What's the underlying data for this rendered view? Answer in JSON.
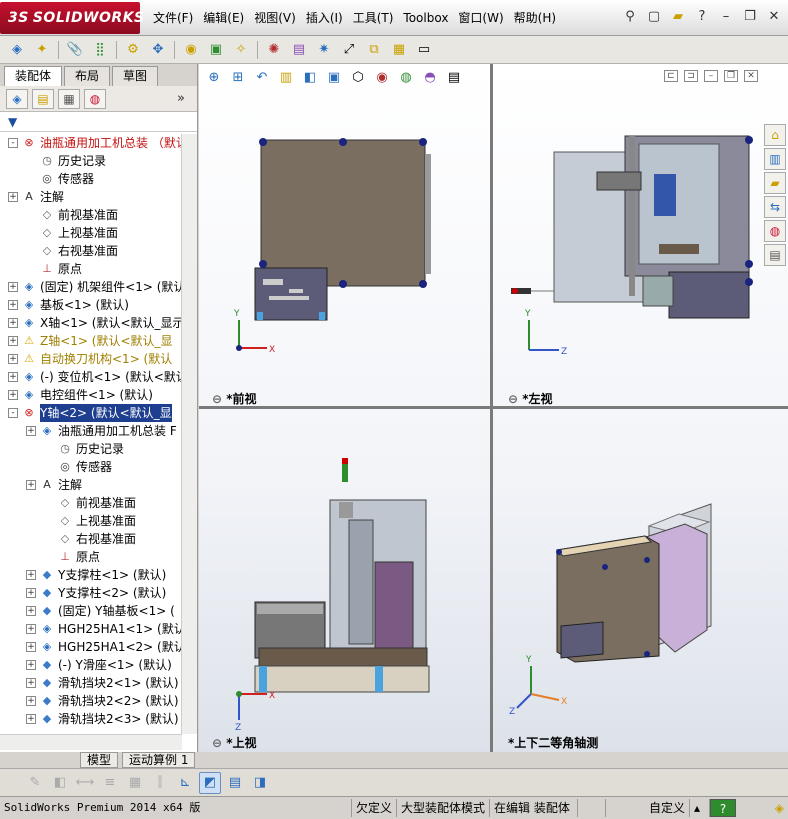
{
  "app": {
    "logo": "SOLIDWORKS",
    "logo_prefix": "3S"
  },
  "menu": [
    "文件(F)",
    "编辑(E)",
    "视图(V)",
    "插入(I)",
    "工具(T)",
    "Toolbox",
    "窗口(W)",
    "帮助(H)"
  ],
  "panel": {
    "tabs": [
      "装配体",
      "布局",
      "草图"
    ],
    "filter_label": "▼",
    "tree": [
      {
        "label": "油瓶通用加工机总装 （默认",
        "icon": "assembly-error-icon",
        "indent": 0,
        "exp": "-",
        "style": "red"
      },
      {
        "label": "历史记录",
        "icon": "history-icon",
        "indent": 1,
        "exp": "",
        "style": ""
      },
      {
        "label": "传感器",
        "icon": "sensor-icon",
        "indent": 1,
        "exp": "",
        "style": ""
      },
      {
        "label": "注解",
        "icon": "annotation-icon",
        "indent": 0,
        "exp": "+",
        "style": ""
      },
      {
        "label": "前视基准面",
        "icon": "plane-icon",
        "indent": 1,
        "exp": "",
        "style": ""
      },
      {
        "label": "上视基准面",
        "icon": "plane-icon",
        "indent": 1,
        "exp": "",
        "style": ""
      },
      {
        "label": "右视基准面",
        "icon": "plane-icon",
        "indent": 1,
        "exp": "",
        "style": ""
      },
      {
        "label": "原点",
        "icon": "origin-icon",
        "indent": 1,
        "exp": "",
        "style": ""
      },
      {
        "label": "(固定) 机架组件<1> (默认",
        "icon": "subassembly-icon",
        "indent": 0,
        "exp": "+",
        "style": ""
      },
      {
        "label": "基板<1> (默认)",
        "icon": "subassembly-icon",
        "indent": 0,
        "exp": "+",
        "style": ""
      },
      {
        "label": "X轴<1> (默认<默认_显示状",
        "icon": "subassembly-icon",
        "indent": 0,
        "exp": "+",
        "style": ""
      },
      {
        "label": "Z轴<1> (默认<默认_显",
        "icon": "warning-icon",
        "indent": 0,
        "exp": "+",
        "style": "yel"
      },
      {
        "label": "自动换刀机构<1> (默认",
        "icon": "warning-icon",
        "indent": 0,
        "exp": "+",
        "style": "yel"
      },
      {
        "label": "(-) 变位机<1> (默认<默认",
        "icon": "subassembly-icon",
        "indent": 0,
        "exp": "+",
        "style": ""
      },
      {
        "label": "电控组件<1> (默认)",
        "icon": "subassembly-icon",
        "indent": 0,
        "exp": "+",
        "style": ""
      },
      {
        "label": "Y轴<2> (默认<默认_显",
        "icon": "assembly-error-icon",
        "indent": 0,
        "exp": "-",
        "style": "sel"
      },
      {
        "label": "油瓶通用加工机总装 F",
        "icon": "subassembly-icon",
        "indent": 1,
        "exp": "+",
        "style": ""
      },
      {
        "label": "历史记录",
        "icon": "history-icon",
        "indent": 2,
        "exp": "",
        "style": ""
      },
      {
        "label": "传感器",
        "icon": "sensor-icon",
        "indent": 2,
        "exp": "",
        "style": ""
      },
      {
        "label": "注解",
        "icon": "annotation-icon",
        "indent": 1,
        "exp": "+",
        "style": ""
      },
      {
        "label": "前视基准面",
        "icon": "plane-icon",
        "indent": 2,
        "exp": "",
        "style": ""
      },
      {
        "label": "上视基准面",
        "icon": "plane-icon",
        "indent": 2,
        "exp": "",
        "style": ""
      },
      {
        "label": "右视基准面",
        "icon": "plane-icon",
        "indent": 2,
        "exp": "",
        "style": ""
      },
      {
        "label": "原点",
        "icon": "origin-icon",
        "indent": 2,
        "exp": "",
        "style": ""
      },
      {
        "label": "Y支撑柱<1> (默认)",
        "icon": "part-icon",
        "indent": 1,
        "exp": "+",
        "style": ""
      },
      {
        "label": "Y支撑柱<2> (默认)",
        "icon": "part-icon",
        "indent": 1,
        "exp": "+",
        "style": ""
      },
      {
        "label": "(固定) Y轴基板<1> (",
        "icon": "part-icon",
        "indent": 1,
        "exp": "+",
        "style": ""
      },
      {
        "label": "HGH25HA1<1> (默认<默",
        "icon": "subassembly-icon",
        "indent": 1,
        "exp": "+",
        "style": ""
      },
      {
        "label": "HGH25HA1<2> (默认<默",
        "icon": "subassembly-icon",
        "indent": 1,
        "exp": "+",
        "style": ""
      },
      {
        "label": "(-) Y滑座<1> (默认)",
        "icon": "part-icon",
        "indent": 1,
        "exp": "+",
        "style": ""
      },
      {
        "label": "滑轨挡块2<1> (默认)",
        "icon": "part-icon",
        "indent": 1,
        "exp": "+",
        "style": ""
      },
      {
        "label": "滑轨挡块2<2> (默认)",
        "icon": "part-icon",
        "indent": 1,
        "exp": "+",
        "style": ""
      },
      {
        "label": "滑轨挡块2<3> (默认)",
        "icon": "part-icon",
        "indent": 1,
        "exp": "+",
        "style": ""
      }
    ],
    "bottom_tabs": [
      "模型",
      "运动算例 1"
    ]
  },
  "views": [
    {
      "id": "front",
      "label": "*前视"
    },
    {
      "id": "left",
      "label": "*左视"
    },
    {
      "id": "top",
      "label": "*上视"
    },
    {
      "id": "iso",
      "label": "*上下二等角轴测"
    }
  ],
  "axes": {
    "x": "X",
    "y": "Y",
    "z": "Z"
  },
  "status": {
    "product": "SolidWorks Premium 2014 x64 版",
    "underdefined": "欠定义",
    "large_mode": "大型装配体模式",
    "editing": "在编辑 装配体",
    "custom": "自定义",
    "help": "?"
  },
  "colors": {
    "accent": "#c8102e",
    "selection": "#1e3f8f",
    "housing": "#7a6e60",
    "panel": "#6a6a80"
  }
}
